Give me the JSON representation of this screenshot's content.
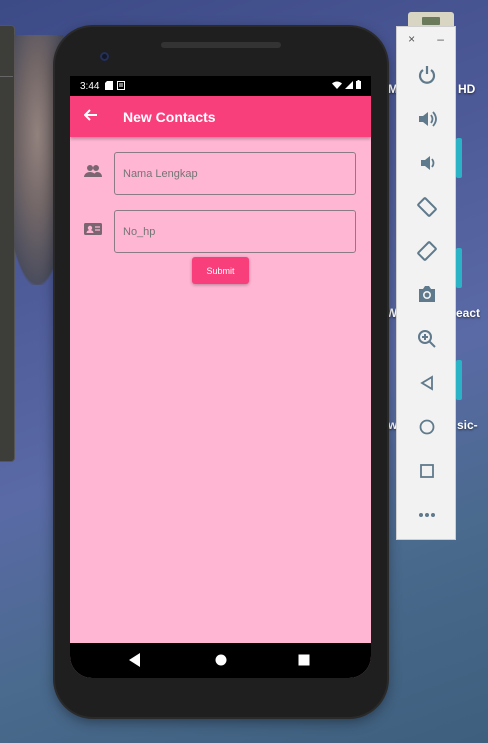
{
  "status_bar": {
    "time": "3:44"
  },
  "app_bar": {
    "title": "New Contacts"
  },
  "form": {
    "name_placeholder": "Nama Lengkap",
    "phone_placeholder": "No_hp",
    "submit_label": "Submit"
  },
  "desktop": {
    "labels": [
      "M",
      "HD",
      "W",
      "eact",
      "w",
      "sic-"
    ]
  },
  "emulator_toolbar": {
    "close_label": "×",
    "minimize_label": "–",
    "buttons": [
      "power-icon",
      "volume-up-icon",
      "volume-down-icon",
      "rotate-left-icon",
      "rotate-right-icon",
      "camera-icon",
      "zoom-icon",
      "back-icon",
      "home-icon",
      "overview-icon",
      "more-icon"
    ]
  },
  "colors": {
    "accent": "#f93e7c",
    "screen_background": "#ffb6d3",
    "toolbar_icon": "#5f7a8c"
  }
}
